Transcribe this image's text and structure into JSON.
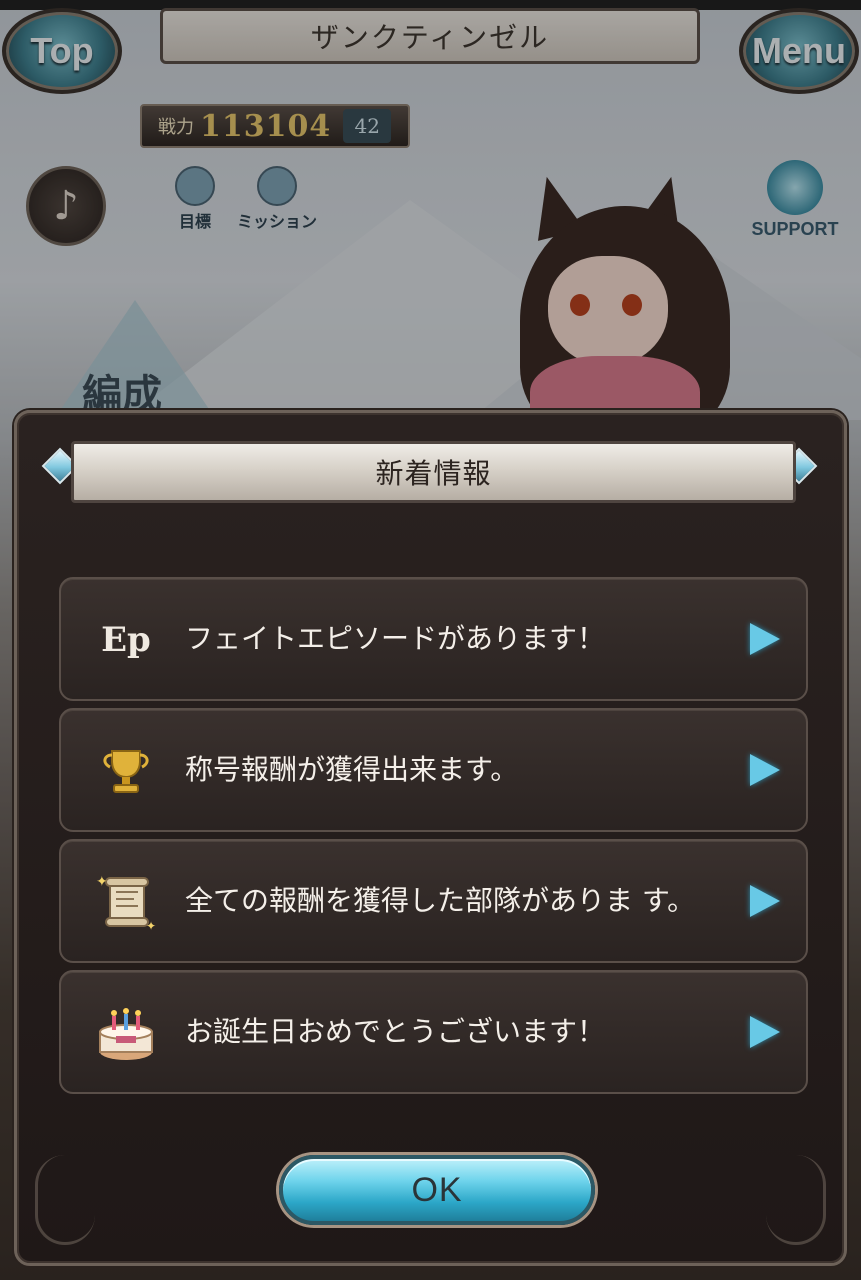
{
  "header": {
    "top_label": "Top",
    "title": "ザンクティンゼル",
    "menu_label": "Menu",
    "power_label": "戦力",
    "power_value": "113104",
    "power_badge": "42"
  },
  "shortcuts": {
    "goal_label": "目標",
    "mission_label": "ミッション",
    "support_label": "SUPPORT",
    "formation_label": "編成"
  },
  "modal": {
    "title": "新着情報",
    "items": [
      {
        "icon": "ep-icon",
        "icon_text": "Ep",
        "text": "フェイトエピソードがあります！"
      },
      {
        "icon": "trophy-icon",
        "text": "称号報酬が獲得出来ます。"
      },
      {
        "icon": "scroll-icon",
        "text": "全ての報酬を獲得した部隊がありま す。"
      },
      {
        "icon": "birthday-cake-icon",
        "text": "お誕生日おめでとうございます！"
      }
    ],
    "ok_label": "OK"
  },
  "colors": {
    "accent_cyan": "#68c9e6",
    "panel_bg": "#2a2220",
    "item_bg": "#3a312e",
    "ok_button": "#2ca7c8"
  }
}
